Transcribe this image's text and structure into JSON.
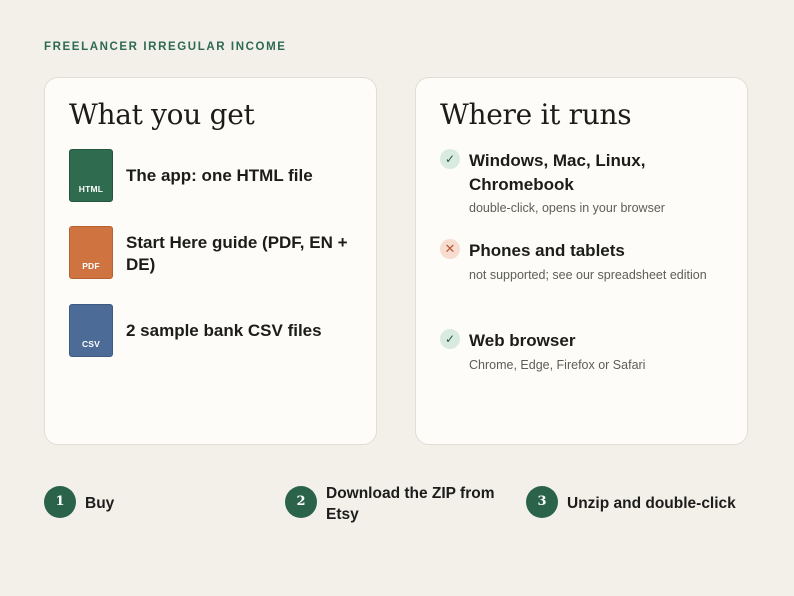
{
  "kicker": "FREELANCER IRREGULAR INCOME",
  "what_you_get": {
    "title": "What you get",
    "items": [
      {
        "ext": "HTML",
        "label": "The app: one HTML file",
        "color": "#2f6b4f",
        "icon": "html-file-icon"
      },
      {
        "ext": "PDF",
        "label": "Start Here guide (PDF, EN + DE)",
        "color": "#cf7440",
        "icon": "pdf-file-icon"
      },
      {
        "ext": "CSV",
        "label": "2 sample bank CSV files",
        "color": "#4c6c97",
        "icon": "csv-file-icon"
      }
    ]
  },
  "where_it_runs": {
    "title": "Where it runs",
    "items": [
      {
        "status": "supported",
        "mark": "✓",
        "title": "Windows, Mac, Linux, Chromebook",
        "desc": "double-click, opens in your browser"
      },
      {
        "status": "not-supported",
        "mark": "✕",
        "title": "Phones and tablets",
        "desc": "not supported; see our spreadsheet edition"
      },
      {
        "status": "supported",
        "mark": "✓",
        "title": "Web browser",
        "desc": "Chrome, Edge, Firefox or Safari"
      }
    ]
  },
  "steps": [
    {
      "num": "1",
      "label": "Buy"
    },
    {
      "num": "2",
      "label": "Download the ZIP from Etsy"
    },
    {
      "num": "3",
      "label": "Unzip and double-click"
    }
  ],
  "colors": {
    "accent": "#2a6349",
    "background": "#f3f0e9",
    "card": "#fdfcf8"
  }
}
